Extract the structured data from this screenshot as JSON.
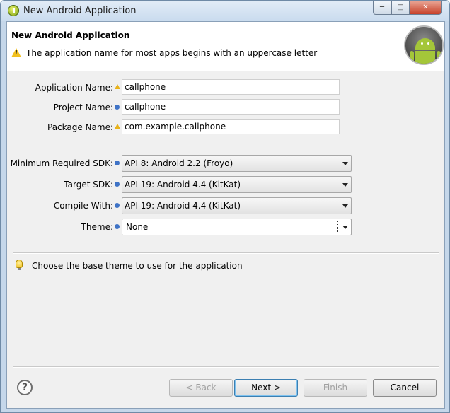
{
  "window": {
    "title": "New Android Application",
    "controls": {
      "minimize": "─",
      "maximize": "□",
      "close": "✕"
    }
  },
  "banner": {
    "title": "New Android Application",
    "message": "The application name for most apps begins with an uppercase letter",
    "icon": "warning-icon",
    "logo": "android-logo"
  },
  "form": {
    "application_name": {
      "label": "Application Name:",
      "value": "callphone",
      "indicator": "warning"
    },
    "project_name": {
      "label": "Project Name:",
      "value": "callphone",
      "indicator": "info"
    },
    "package_name": {
      "label": "Package Name:",
      "value": "com.example.callphone",
      "indicator": "warning"
    },
    "min_sdk": {
      "label": "Minimum Required SDK:",
      "value": "API 8: Android 2.2 (Froyo)",
      "indicator": "info"
    },
    "target_sdk": {
      "label": "Target SDK:",
      "value": "API 19: Android 4.4 (KitKat)",
      "indicator": "info"
    },
    "compile_with": {
      "label": "Compile With:",
      "value": "API 19: Android 4.4 (KitKat)",
      "indicator": "info"
    },
    "theme": {
      "label": "Theme:",
      "value": "None",
      "indicator": "info"
    }
  },
  "hint": {
    "text": "Choose the base theme to use for the application",
    "icon": "lightbulb-icon"
  },
  "footer": {
    "help_icon": "help-icon",
    "help_glyph": "?",
    "back": "< Back",
    "next": "Next >",
    "finish": "Finish",
    "cancel": "Cancel"
  }
}
